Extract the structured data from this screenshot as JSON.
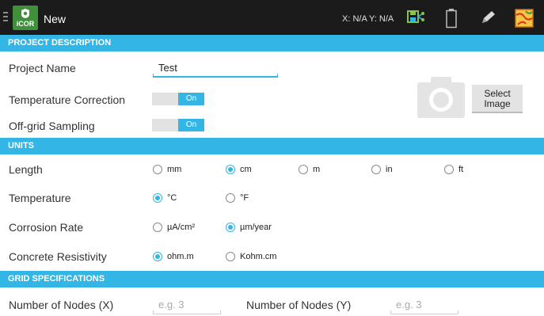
{
  "app": {
    "logo_text": "iCOR",
    "title": "New",
    "coords": "X: N/A Y: N/A"
  },
  "actionbar": {
    "icons": [
      "menu-icon",
      "save-network-icon",
      "battery-icon",
      "pen-icon",
      "map-icon"
    ]
  },
  "colors": {
    "accent": "#33b5e5",
    "actionbar_bg": "#1b1b1b",
    "logo_green": "#3f8f3b"
  },
  "project": {
    "header": "PROJECT DESCRIPTION",
    "name_label": "Project Name",
    "name_value": "Test",
    "temp_correction_label": "Temperature Correction",
    "temp_correction_state": "On",
    "offgrid_label": "Off-grid Sampling",
    "offgrid_state": "On",
    "select_image_line1": "Select",
    "select_image_line2": "Image"
  },
  "units": {
    "header": "UNITS",
    "length_label": "Length",
    "length_options": [
      "mm",
      "cm",
      "m",
      "in",
      "ft"
    ],
    "length_selected": "cm",
    "temperature_label": "Temperature",
    "temperature_options": [
      "°C",
      "°F"
    ],
    "temperature_selected": "°C",
    "corrosion_label": "Corrosion Rate",
    "corrosion_options": [
      "µA/cm²",
      "µm/year"
    ],
    "corrosion_selected": "µm/year",
    "resistivity_label": "Concrete Resistivity",
    "resistivity_options": [
      "ohm.m",
      "Kohm.cm"
    ],
    "resistivity_selected": "ohm.m"
  },
  "grid": {
    "header": "GRID SPECIFICATIONS",
    "nodes_x_label": "Number of Nodes (X)",
    "nodes_x_placeholder": "e.g. 3",
    "nodes_y_label": "Number of Nodes (Y)",
    "nodes_y_placeholder": "e.g. 3"
  }
}
